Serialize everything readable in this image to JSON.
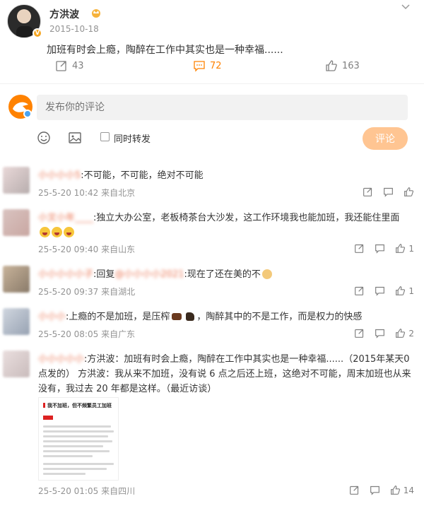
{
  "post": {
    "author": "方洪波",
    "date": "2015-10-18",
    "text": "加班有时会上瘾，陶醉在工作中其实也是一种幸福......",
    "reposts": "43",
    "comments": "72",
    "likes": "163"
  },
  "composer": {
    "placeholder": "发布你的评论",
    "repost_label": "同时转发",
    "submit_label": "评论"
  },
  "comments": [
    {
      "name": "小小小小5",
      "text": ":不可能，不可能，绝对不可能",
      "time": "25-5-20 10:42",
      "location": "来自北京",
      "likes": ""
    },
    {
      "name": "小文小年____",
      "text": ":独立大办公室，老板椅茶台大沙发，这工作环境我也能加班，我还能住里面",
      "time": "25-5-20 09:40",
      "location": "来自山东",
      "likes": "1"
    },
    {
      "name": "小小小小小子",
      "reply_prefix": ":回复",
      "mention": "@小小小小2021",
      "text": ":现在了还在美的不",
      "time": "25-5-20 09:37",
      "location": "来自湖北",
      "likes": "1"
    },
    {
      "name": "小小小",
      "text_a": ":上瘾的不是加班，是压榨",
      "text_b": "，陶醉其中的不是工作，而是权力的快感",
      "time": "25-5-20 08:05",
      "location": "来自广东",
      "likes": "2"
    },
    {
      "name": "小小小小小",
      "text": ":方洪波：加班有时会上瘾，陶醉在工作中其实也是一种幸福......（2015年某天0点发的） 方洪波：我从来不加班，没有说 6 点之后还上班，这绝对不可能，周末加班也从来没有，我过去 20 年都是这样。（最近访谈）",
      "time": "25-5-20 01:05",
      "location": "来自四川",
      "likes": "14",
      "thumb_title": "我不加班，但不频繁员工加班"
    }
  ],
  "colors": {
    "accent": "#ff8200",
    "link": "#eb7350",
    "meta": "#939393"
  }
}
